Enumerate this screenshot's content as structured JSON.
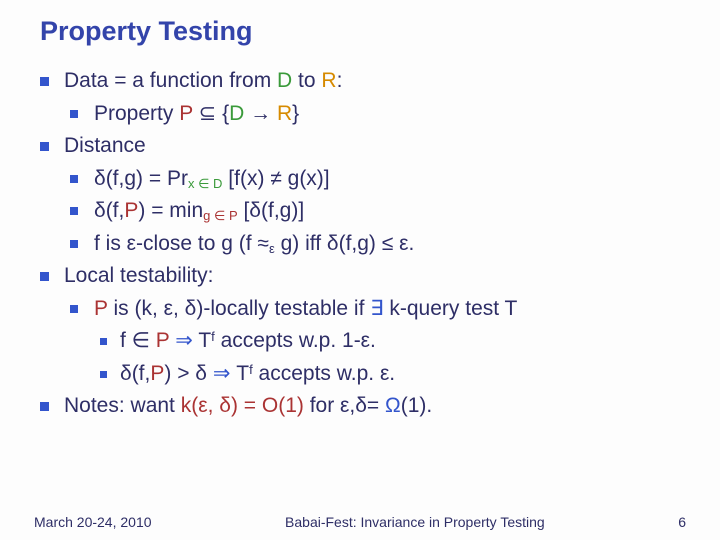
{
  "title": "Property Testing",
  "items": {
    "l1": {
      "pre": "Data = a function from ",
      "D": "D",
      "to": " to ",
      "R": "R",
      "post": ":"
    },
    "l1a": {
      "pre": "Property ",
      "P": "P",
      "sub": " ⊆ {",
      "D": "D",
      "arrow": " → ",
      "R": "R",
      "end": "}"
    },
    "l2": "Distance",
    "l2a": {
      "pre": "δ(f,g) = Pr",
      "subtxt": "x ∈ D",
      "mid": " [f(x) ≠ g(x)]"
    },
    "l2b": {
      "pre": "δ(f,",
      "P": "P",
      "post": ") = min",
      "subtxt": "g ∈ P",
      "mid": " [δ(f,g)]"
    },
    "l2c": {
      "pre": "f is ε-close to g (f ≈",
      "subeps": "ε",
      "post": " g) iff δ(f,g) ≤ ε."
    },
    "l3": "Local testability:",
    "l3a": {
      "P": "P",
      "mid": " is (k, ε, δ)-locally testable if ",
      "exists": "∃",
      "tail": " k-query test T"
    },
    "l3a1": {
      "pre": "f ∈ ",
      "P": "P",
      "imp": " ⇒ ",
      "T": "T",
      "sup": "f",
      "tail": " accepts w.p. 1-ε."
    },
    "l3a2": {
      "pre": "δ(f,",
      "P": "P",
      "post": ") > δ ",
      "imp": "⇒ ",
      "T": "T",
      "sup": "f",
      "tail": " accepts w.p. ε."
    },
    "l4": {
      "pre": "Notes: want ",
      "k": "k(ε, δ) = O(1)",
      "for": " for  ε,δ= ",
      "omega": "Ω",
      "end": "(1)."
    }
  },
  "footer": {
    "left": "March 20-24, 2010",
    "center": "Babai-Fest: Invariance in Property Testing",
    "right": "6"
  }
}
